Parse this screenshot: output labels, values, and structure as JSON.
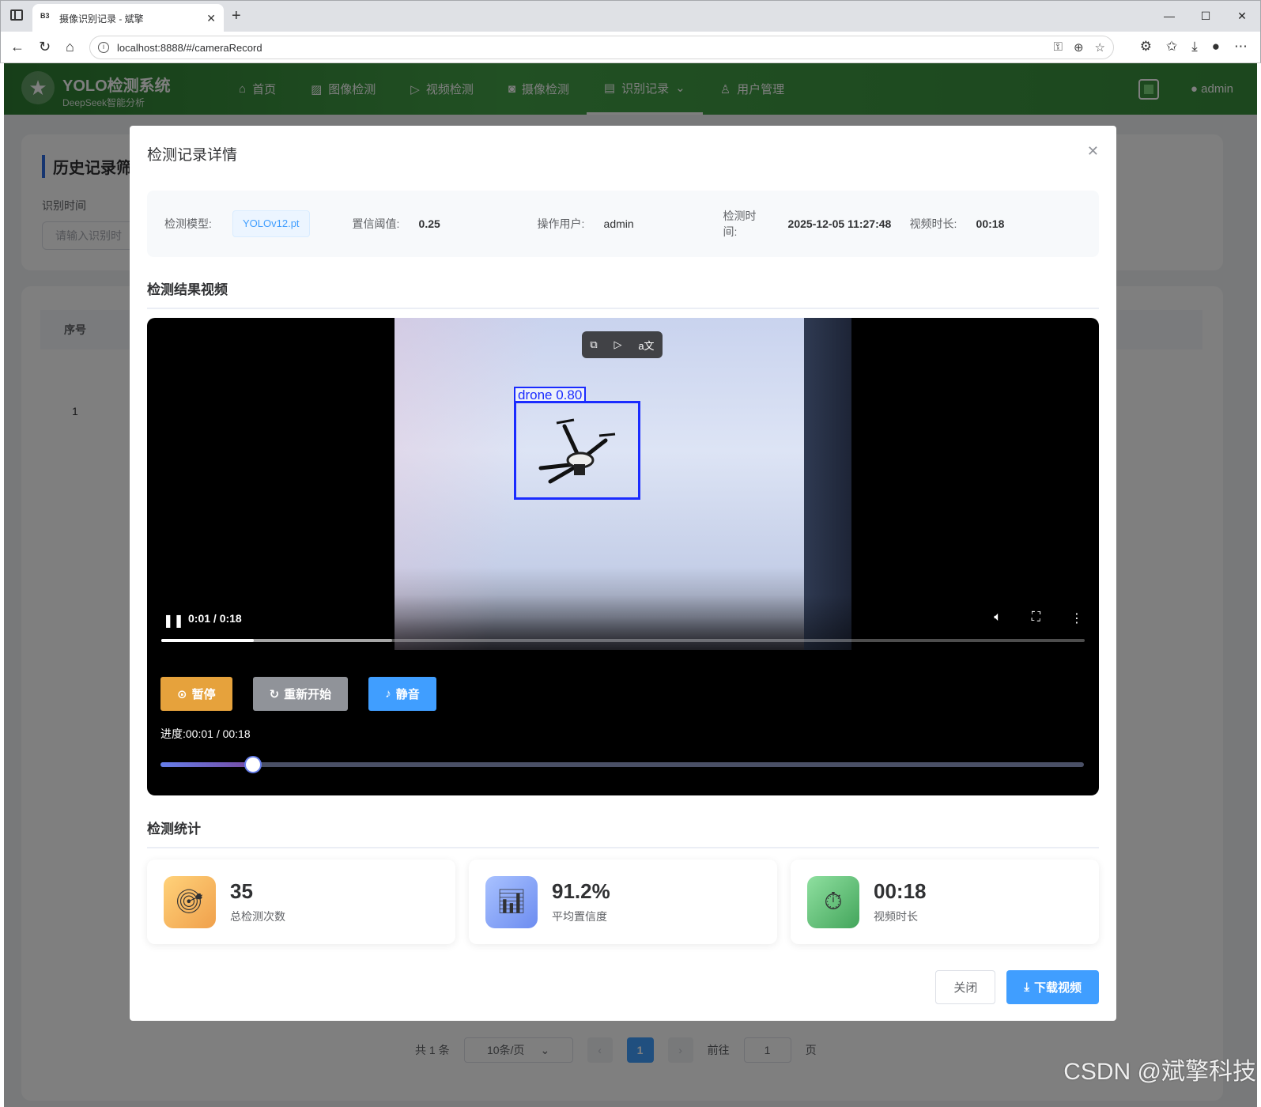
{
  "browser": {
    "tab_title": "摄像识别记录 - 斌擎",
    "tab_favicon": "B3",
    "url": "localhost:8888/#/cameraRecord"
  },
  "app": {
    "brand_title": "YOLO检测系统",
    "brand_subtitle": "DeepSeek智能分析",
    "nav": [
      {
        "label": "首页",
        "icon": "home-icon"
      },
      {
        "label": "图像检测",
        "icon": "image-icon"
      },
      {
        "label": "视频检测",
        "icon": "play-circle-icon"
      },
      {
        "label": "摄像检测",
        "icon": "camera-icon"
      },
      {
        "label": "识别记录",
        "icon": "document-icon"
      },
      {
        "label": "用户管理",
        "icon": "user-icon"
      }
    ],
    "user": "admin"
  },
  "background": {
    "filter_title": "历史记录筛",
    "filter_label": "识别时间",
    "filter_placeholder": "请输入识别时",
    "table_header_index": "序号",
    "row_index": "1",
    "pager": {
      "total": "共 1 条",
      "page_size": "10条/页",
      "current": "1",
      "goto_label": "前往",
      "goto_value": "1",
      "page_suffix": "页"
    }
  },
  "dialog": {
    "title": "检测记录详情",
    "info": {
      "model_label": "检测模型:",
      "model_value": "YOLOv12.pt",
      "conf_label": "置信阈值:",
      "conf_value": "0.25",
      "user_label": "操作用户:",
      "user_value": "admin",
      "time_label": "检测时间:",
      "time_value": "2025-12-05 11:27:48",
      "dur_label": "视频时长:",
      "dur_value": "00:18"
    },
    "video_section_title": "检测结果视频",
    "video": {
      "detection_label": "drone 0.80",
      "time_display": "0:01 / 0:18",
      "progress_fraction": 0.1,
      "buffered_fraction": 0.25
    },
    "controls": {
      "pause": "暂停",
      "restart": "重新开始",
      "mute": "静音",
      "progress_text": "进度:00:01 / 00:18",
      "slider_fraction": 0.1
    },
    "stats_section_title": "检测统计",
    "stats": [
      {
        "value": "35",
        "label": "总检测次数",
        "icon": "target-icon"
      },
      {
        "value": "91.2%",
        "label": "平均置信度",
        "icon": "bar-chart-icon"
      },
      {
        "value": "00:18",
        "label": "视频时长",
        "icon": "stopwatch-icon"
      }
    ],
    "close_button": "关闭",
    "download_button": "下载视频"
  },
  "watermark": "CSDN @斌擎科技"
}
